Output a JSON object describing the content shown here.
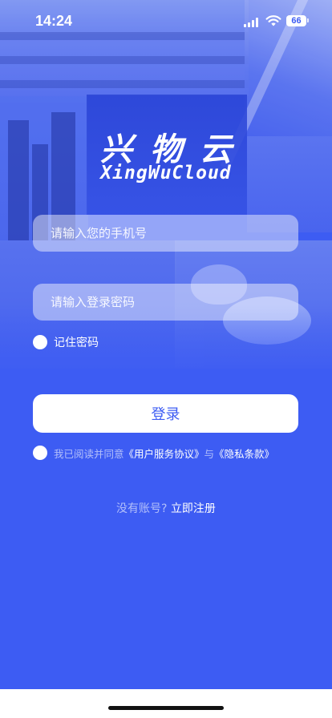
{
  "status_bar": {
    "time": "14:24",
    "battery": "66"
  },
  "logo": {
    "chinese": "兴物云",
    "english": "XingWuCloud"
  },
  "form": {
    "phone_placeholder": "请输入您的手机号",
    "password_placeholder": "请输入登录密码",
    "remember_label": "记住密码",
    "login_label": "登录"
  },
  "agreement": {
    "prefix": "我已阅读并同意",
    "terms": "《用户服务协议》",
    "and": "与",
    "privacy": "《隐私条款》"
  },
  "register": {
    "question": "没有账号?",
    "link": "立即注册"
  },
  "colors": {
    "brand": "#3d5cf3",
    "button_bg": "#ffffff"
  }
}
